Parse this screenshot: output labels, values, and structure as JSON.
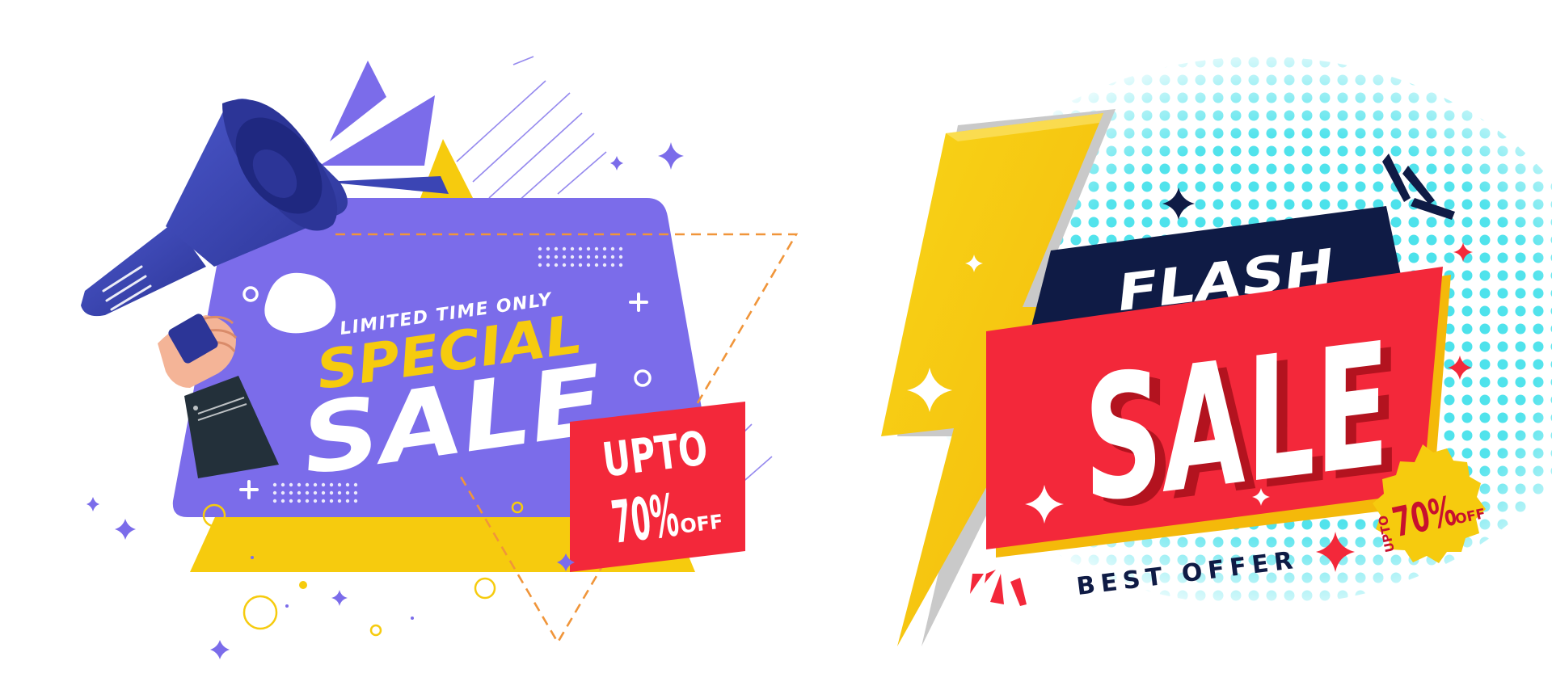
{
  "special_banner": {
    "kicker": "LIMITED TIME ONLY",
    "headline": "SPECIAL",
    "word": "SALE",
    "tag_line1": "UPTO",
    "tag_percent": "70%",
    "tag_off": "OFF"
  },
  "flash_banner": {
    "title": "FLASH",
    "word": "SALE",
    "subtitle": "BEST OFFER",
    "badge_prefix": "UPTO",
    "badge_percent": "70%",
    "badge_off": "OFF"
  },
  "colors": {
    "purple": "#7b6cea",
    "megaphone_blue": "#3b45b4",
    "yellow": "#f6cb0e",
    "red": "#f3283a",
    "navy": "#0f1b45",
    "cyan_dots": "#3fe0ea",
    "orange_dashes": "#f0953a"
  },
  "icons": [
    "megaphone-icon",
    "lightning-bolt-icon",
    "sparkle-icon",
    "plus-icon",
    "ring-icon"
  ]
}
